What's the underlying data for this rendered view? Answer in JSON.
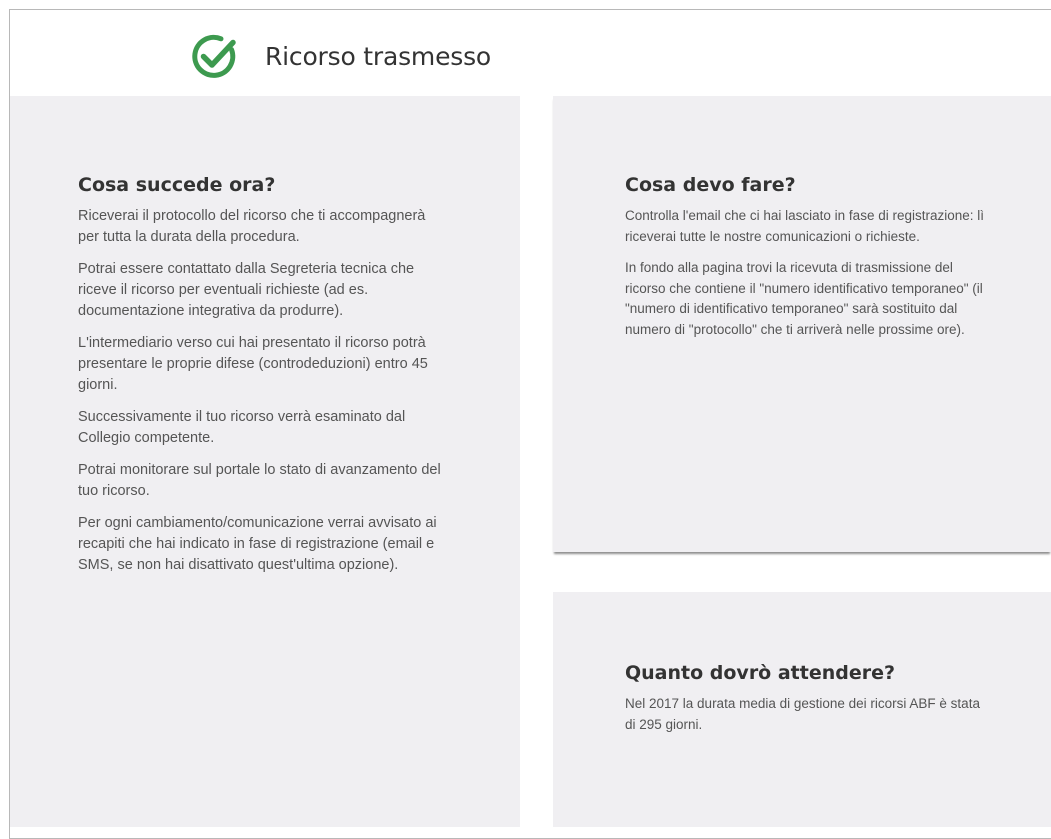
{
  "header": {
    "title": "Ricorso trasmesso",
    "icon": "check-circle-icon",
    "icon_color": "#3d9a4f"
  },
  "cards": {
    "left": {
      "heading": "Cosa succede ora?",
      "paragraphs": [
        "Riceverai il protocollo del ricorso che ti accompagnerà per tutta la durata della procedura.",
        "Potrai essere contattato dalla Segreteria tecnica che riceve il ricorso per eventuali richieste (ad es. documentazione integrativa da produrre).",
        "L'intermediario verso cui hai presentato il ricorso potrà presentare le proprie difese (controdeduzioni) entro 45 giorni.",
        "Successivamente il tuo ricorso verrà esaminato dal Collegio competente.",
        "Potrai monitorare sul portale lo stato di avanzamento del tuo ricorso.",
        "Per ogni cambiamento/comunicazione verrai avvisato ai recapiti che hai indicato in fase di registrazione (email e SMS, se non hai disattivato quest'ultima opzione)."
      ]
    },
    "right_top": {
      "heading": "Cosa devo fare?",
      "paragraphs": [
        "Controlla l'email che ci hai lasciato in fase di registrazione: lì riceverai tutte le nostre comunicazioni o richieste.",
        "In fondo alla pagina trovi la ricevuta di trasmissione del ricorso che contiene il \"numero identificativo temporaneo\" (il \"numero di identificativo temporaneo\" sarà sostituito dal numero di \"protocollo\" che ti arriverà nelle prossime ore)."
      ]
    },
    "right_bottom": {
      "heading": "Quanto dovrò attendere?",
      "paragraphs": [
        "Nel 2017 la durata media di gestione dei ricorsi ABF è stata di 295 giorni."
      ]
    }
  }
}
